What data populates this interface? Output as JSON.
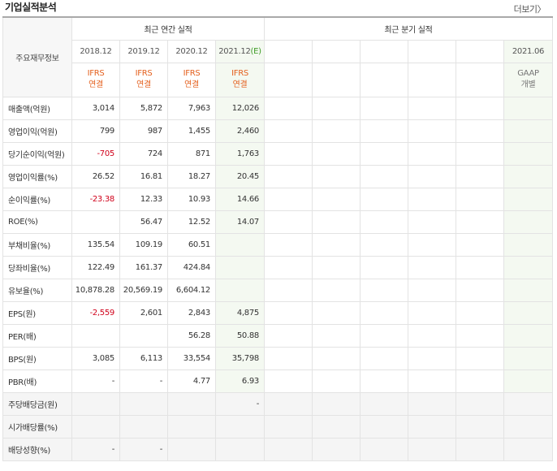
{
  "panel": {
    "title": "기업실적분석",
    "more_label": "더보기"
  },
  "header": {
    "row_label": "주요재무정보",
    "annual_label": "최근 연간 실적",
    "quarter_label": "최근 분기 실적",
    "annual_periods": [
      "2018.12",
      "2019.12",
      "2020.12",
      "2021.12"
    ],
    "estimate_marker": "(E)",
    "quarter_last_period": "2021.06",
    "annual_standards": [
      {
        "std": "IFRS",
        "type": "연결"
      },
      {
        "std": "IFRS",
        "type": "연결"
      },
      {
        "std": "IFRS",
        "type": "연결"
      },
      {
        "std": "IFRS",
        "type": "연결"
      }
    ],
    "quarter_last_standard": {
      "std": "GAAP",
      "type": "개별"
    }
  },
  "rows": [
    {
      "label": "매출액(억원)",
      "values": [
        "3,014",
        "5,872",
        "7,963",
        "12,026"
      ]
    },
    {
      "label": "영업이익(억원)",
      "values": [
        "799",
        "987",
        "1,455",
        "2,460"
      ]
    },
    {
      "label": "당기순이익(억원)",
      "values": [
        "-705",
        "724",
        "871",
        "1,763"
      ]
    },
    {
      "label": "영업이익률(%)",
      "values": [
        "26.52",
        "16.81",
        "18.27",
        "20.45"
      ]
    },
    {
      "label": "순이익률(%)",
      "values": [
        "-23.38",
        "12.33",
        "10.93",
        "14.66"
      ]
    },
    {
      "label": "ROE(%)",
      "values": [
        "",
        "56.47",
        "12.52",
        "14.07"
      ]
    },
    {
      "label": "부채비율(%)",
      "values": [
        "135.54",
        "109.19",
        "60.51",
        ""
      ]
    },
    {
      "label": "당좌비율(%)",
      "values": [
        "122.49",
        "161.37",
        "424.84",
        ""
      ]
    },
    {
      "label": "유보율(%)",
      "values": [
        "10,878.28",
        "20,569.19",
        "6,604.12",
        ""
      ]
    },
    {
      "label": "EPS(원)",
      "values": [
        "-2,559",
        "2,601",
        "2,843",
        "4,875"
      ]
    },
    {
      "label": "PER(배)",
      "values": [
        "",
        "",
        "56.28",
        "50.88"
      ]
    },
    {
      "label": "BPS(원)",
      "values": [
        "3,085",
        "6,113",
        "33,554",
        "35,798"
      ]
    },
    {
      "label": "PBR(배)",
      "values": [
        "-",
        "-",
        "4.77",
        "6.93"
      ]
    },
    {
      "label": "주당배당금(원)",
      "values": [
        "",
        "",
        "",
        "-"
      ]
    },
    {
      "label": "시가배당률(%)",
      "values": [
        "",
        "",
        "",
        ""
      ]
    },
    {
      "label": "배당성향(%)",
      "values": [
        "-",
        "-",
        "",
        ""
      ]
    }
  ],
  "colors": {
    "negative": "#d0021b",
    "ifrs": "#e4611f",
    "estimate_marker": "#3d9b25"
  }
}
